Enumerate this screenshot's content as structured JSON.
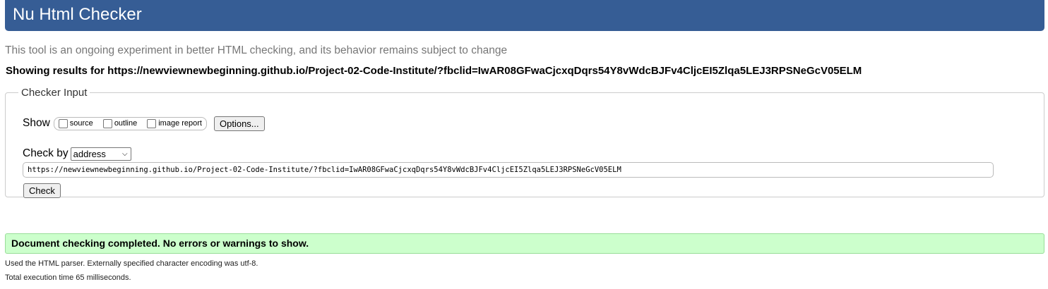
{
  "header": {
    "title": "Nu Html Checker",
    "background_color": "#365d95"
  },
  "tagline": "This tool is an ongoing experiment in better HTML checking, and its behavior remains subject to change",
  "showing_results": "Showing results for https://newviewnewbeginning.github.io/Project-02-Code-Institute/?fbclid=IwAR08GFwaCjcxqDqrs54Y8vWdcBJFv4CljcEI5Zlqa5LEJ3RPSNeGcV05ELM",
  "checker_input": {
    "legend": "Checker Input",
    "show_label": "Show",
    "show_options": [
      {
        "label": "source",
        "checked": false
      },
      {
        "label": "outline",
        "checked": false
      },
      {
        "label": "image report",
        "checked": false
      }
    ],
    "options_button": "Options...",
    "check_by_label": "Check by",
    "check_by_selected": "address",
    "url_value": "https://newviewnewbeginning.github.io/Project-02-Code-Institute/?fbclid=IwAR08GFwaCjcxqDqrs54Y8vWdcBJFv4CljcEI5Zlqa5LEJ3RPSNeGcV05ELM",
    "check_button": "Check"
  },
  "result": {
    "message": "Document checking completed. No errors or warnings to show.",
    "background_color": "#ccffcc"
  },
  "details": {
    "parser": "Used the HTML parser. Externally specified character encoding was utf-8.",
    "execution_time": "Total execution time 65 milliseconds."
  }
}
